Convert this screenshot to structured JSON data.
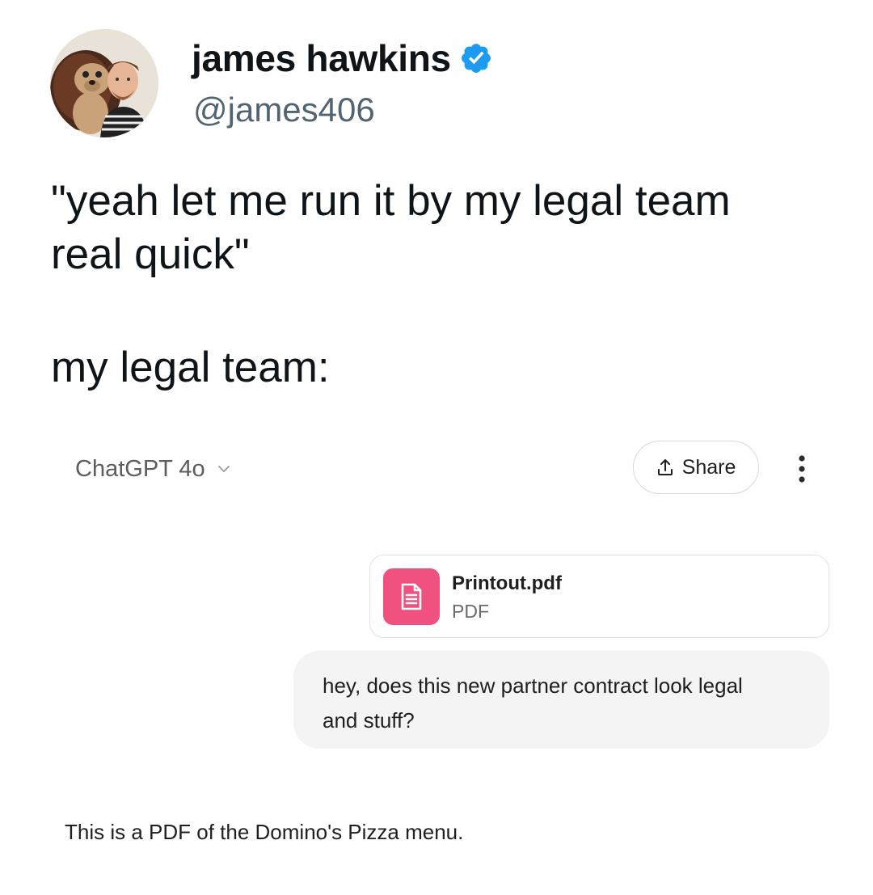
{
  "tweet": {
    "display_name": "james hawkins",
    "verified": true,
    "handle": "@james406",
    "lines": [
      "\"yeah let me run it by my legal team",
      "real quick\"",
      "",
      "my legal team:"
    ]
  },
  "chat": {
    "model_label": "ChatGPT 4o",
    "model_selector_icon": "chevron-down-icon",
    "share_label": "Share",
    "share_icon": "share-icon",
    "more_icon": "more-vertical-icon",
    "attachment": {
      "name": "Printout.pdf",
      "type": "PDF",
      "icon": "document-icon",
      "icon_color": "#f0517e"
    },
    "user_message_lines": [
      "hey, does this new partner contract look legal",
      "and stuff?"
    ],
    "assistant_reply": "This is a PDF of the Domino's Pizza menu."
  },
  "colors": {
    "verified_badge": "#1d9bf0",
    "handle": "#536471",
    "bubble_background": "#f4f4f4"
  }
}
